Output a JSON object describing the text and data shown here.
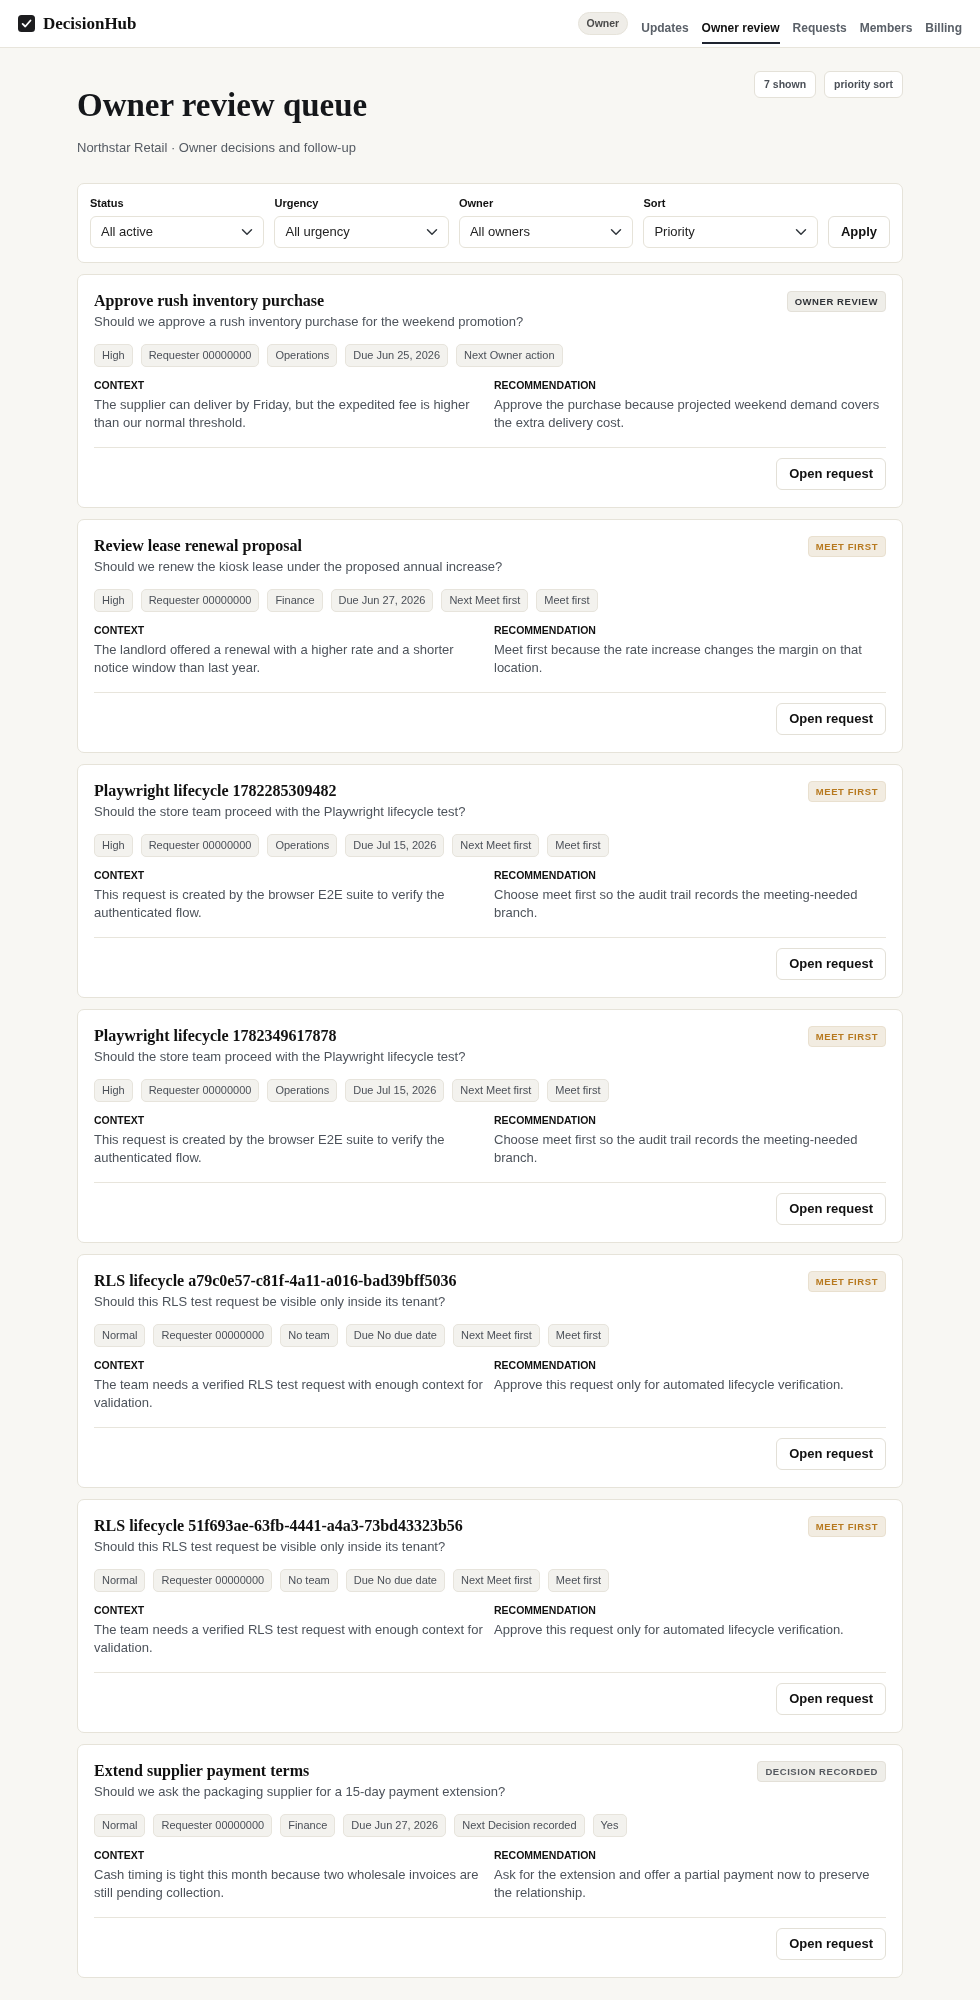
{
  "header": {
    "brand": "DecisionHub",
    "role": "Owner",
    "nav": [
      {
        "label": "Updates",
        "selected": false
      },
      {
        "label": "Owner review",
        "selected": true
      },
      {
        "label": "Requests",
        "selected": false
      },
      {
        "label": "Members",
        "selected": false
      },
      {
        "label": "Billing",
        "selected": false
      }
    ]
  },
  "page": {
    "title": "Owner review queue",
    "subtitle": "Northstar Retail · Owner decisions and follow-up",
    "badges": [
      "7 shown",
      "priority sort"
    ]
  },
  "filters": {
    "fields": [
      {
        "label": "Status",
        "value": "All active"
      },
      {
        "label": "Urgency",
        "value": "All urgency"
      },
      {
        "label": "Owner",
        "value": "All owners"
      },
      {
        "label": "Sort",
        "value": "Priority"
      }
    ],
    "apply": "Apply"
  },
  "requests": [
    {
      "title": "Approve rush inventory purchase",
      "status": {
        "label": "OWNER REVIEW",
        "kind": "neutral"
      },
      "question": "Should we approve a rush inventory purchase for the weekend promotion?",
      "tags": [
        "High",
        "Requester 00000000",
        "Operations",
        "Due Jun 25, 2026",
        "Next Owner action"
      ],
      "context": {
        "label": "CONTEXT",
        "text": "The supplier can deliver by Friday, but the expedited fee is higher than our normal threshold."
      },
      "recommendation": {
        "label": "RECOMMENDATION",
        "text": "Approve the purchase because projected weekend demand covers the extra delivery cost."
      },
      "action": "Open request"
    },
    {
      "title": "Review lease renewal proposal",
      "status": {
        "label": "MEET FIRST",
        "kind": "warning"
      },
      "question": "Should we renew the kiosk lease under the proposed annual increase?",
      "tags": [
        "High",
        "Requester 00000000",
        "Finance",
        "Due Jun 27, 2026",
        "Next Meet first",
        "Meet first"
      ],
      "context": {
        "label": "CONTEXT",
        "text": "The landlord offered a renewal with a higher rate and a shorter notice window than last year."
      },
      "recommendation": {
        "label": "RECOMMENDATION",
        "text": "Meet first because the rate increase changes the margin on that location."
      },
      "action": "Open request"
    },
    {
      "title": "Playwright lifecycle 1782285309482",
      "status": {
        "label": "MEET FIRST",
        "kind": "warning"
      },
      "question": "Should the store team proceed with the Playwright lifecycle test?",
      "tags": [
        "High",
        "Requester 00000000",
        "Operations",
        "Due Jul 15, 2026",
        "Next Meet first",
        "Meet first"
      ],
      "context": {
        "label": "CONTEXT",
        "text": "This request is created by the browser E2E suite to verify the authenticated flow."
      },
      "recommendation": {
        "label": "RECOMMENDATION",
        "text": "Choose meet first so the audit trail records the meeting-needed branch."
      },
      "action": "Open request"
    },
    {
      "title": "Playwright lifecycle 1782349617878",
      "status": {
        "label": "MEET FIRST",
        "kind": "warning"
      },
      "question": "Should the store team proceed with the Playwright lifecycle test?",
      "tags": [
        "High",
        "Requester 00000000",
        "Operations",
        "Due Jul 15, 2026",
        "Next Meet first",
        "Meet first"
      ],
      "context": {
        "label": "CONTEXT",
        "text": "This request is created by the browser E2E suite to verify the authenticated flow."
      },
      "recommendation": {
        "label": "RECOMMENDATION",
        "text": "Choose meet first so the audit trail records the meeting-needed branch."
      },
      "action": "Open request"
    },
    {
      "title": "RLS lifecycle a79c0e57-c81f-4a11-a016-bad39bff5036",
      "status": {
        "label": "MEET FIRST",
        "kind": "warning"
      },
      "question": "Should this RLS test request be visible only inside its tenant?",
      "tags": [
        "Normal",
        "Requester 00000000",
        "No team",
        "Due No due date",
        "Next Meet first",
        "Meet first"
      ],
      "context": {
        "label": "CONTEXT",
        "text": "The team needs a verified RLS test request with enough context for validation."
      },
      "recommendation": {
        "label": "RECOMMENDATION",
        "text": "Approve this request only for automated lifecycle verification."
      },
      "action": "Open request"
    },
    {
      "title": "RLS lifecycle 51f693ae-63fb-4441-a4a3-73bd43323b56",
      "status": {
        "label": "MEET FIRST",
        "kind": "warning"
      },
      "question": "Should this RLS test request be visible only inside its tenant?",
      "tags": [
        "Normal",
        "Requester 00000000",
        "No team",
        "Due No due date",
        "Next Meet first",
        "Meet first"
      ],
      "context": {
        "label": "CONTEXT",
        "text": "The team needs a verified RLS test request with enough context for validation."
      },
      "recommendation": {
        "label": "RECOMMENDATION",
        "text": "Approve this request only for automated lifecycle verification."
      },
      "action": "Open request"
    },
    {
      "title": "Extend supplier payment terms",
      "status": {
        "label": "DECISION RECORDED",
        "kind": "muted"
      },
      "question": "Should we ask the packaging supplier for a 15-day payment extension?",
      "tags": [
        "Normal",
        "Requester 00000000",
        "Finance",
        "Due Jun 27, 2026",
        "Next Decision recorded",
        "Yes"
      ],
      "context": {
        "label": "CONTEXT",
        "text": "Cash timing is tight this month because two wholesale invoices are still pending collection."
      },
      "recommendation": {
        "label": "RECOMMENDATION",
        "text": "Ask for the extension and offer a partial payment now to preserve the relationship."
      },
      "action": "Open request"
    }
  ]
}
